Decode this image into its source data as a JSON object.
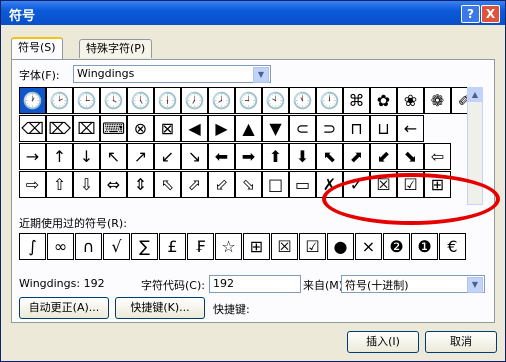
{
  "window": {
    "title": "符号",
    "help_label": "?",
    "close_label": "X"
  },
  "tabs": [
    {
      "label": "符号(S)"
    },
    {
      "label": "特殊字符(P)"
    }
  ],
  "font": {
    "label": "字体(F):",
    "value": "Wingdings"
  },
  "symbols": [
    [
      "🕐",
      "🕑",
      "🕒",
      "🕓",
      "🕔",
      "🕕",
      "🕖",
      "🕗",
      "🕘",
      "🕙",
      "🕚",
      "🕛",
      "⌘",
      "✿",
      "❀",
      "❁",
      "✐"
    ],
    [
      "⌫",
      "⌦",
      "⌧",
      "⌨",
      "⊗",
      "⊠",
      "◀",
      "▶",
      "▲",
      "▼",
      "⊂",
      "⊃",
      "⊓",
      "⊔",
      "←"
    ],
    [
      "→",
      "↑",
      "↓",
      "↖",
      "↗",
      "↙",
      "↘",
      "⬅",
      "➡",
      "⬆",
      "⬇",
      "⬉",
      "⬈",
      "⬋",
      "⬊",
      "⇦"
    ],
    [
      "⇨",
      "⇧",
      "⇩",
      "⇔",
      "⇕",
      "⬁",
      "⬀",
      "⬃",
      "⬂",
      "□",
      "▭",
      "✗",
      "✓",
      "☒",
      "☑",
      "⊞"
    ]
  ],
  "recent": {
    "label": "近期使用过的符号(R):",
    "items": [
      "∫",
      "∞",
      "∩",
      "√",
      "∑",
      "£",
      "₣",
      "☆",
      "⊞",
      "☒",
      "☑",
      "●",
      "×",
      "❷",
      "❶",
      "€"
    ]
  },
  "code": {
    "font_info": "Wingdings: 192",
    "char_code_label": "字符代码(C):",
    "char_code_value": "192",
    "from_label": "来自(M):",
    "from_value": "符号(十进制)"
  },
  "buttons": {
    "autocorrect": "自动更正(A)...",
    "shortcut_key": "快捷键(K)...",
    "shortcut_label": "快捷键:",
    "insert": "插入(I)",
    "cancel": "取消"
  }
}
